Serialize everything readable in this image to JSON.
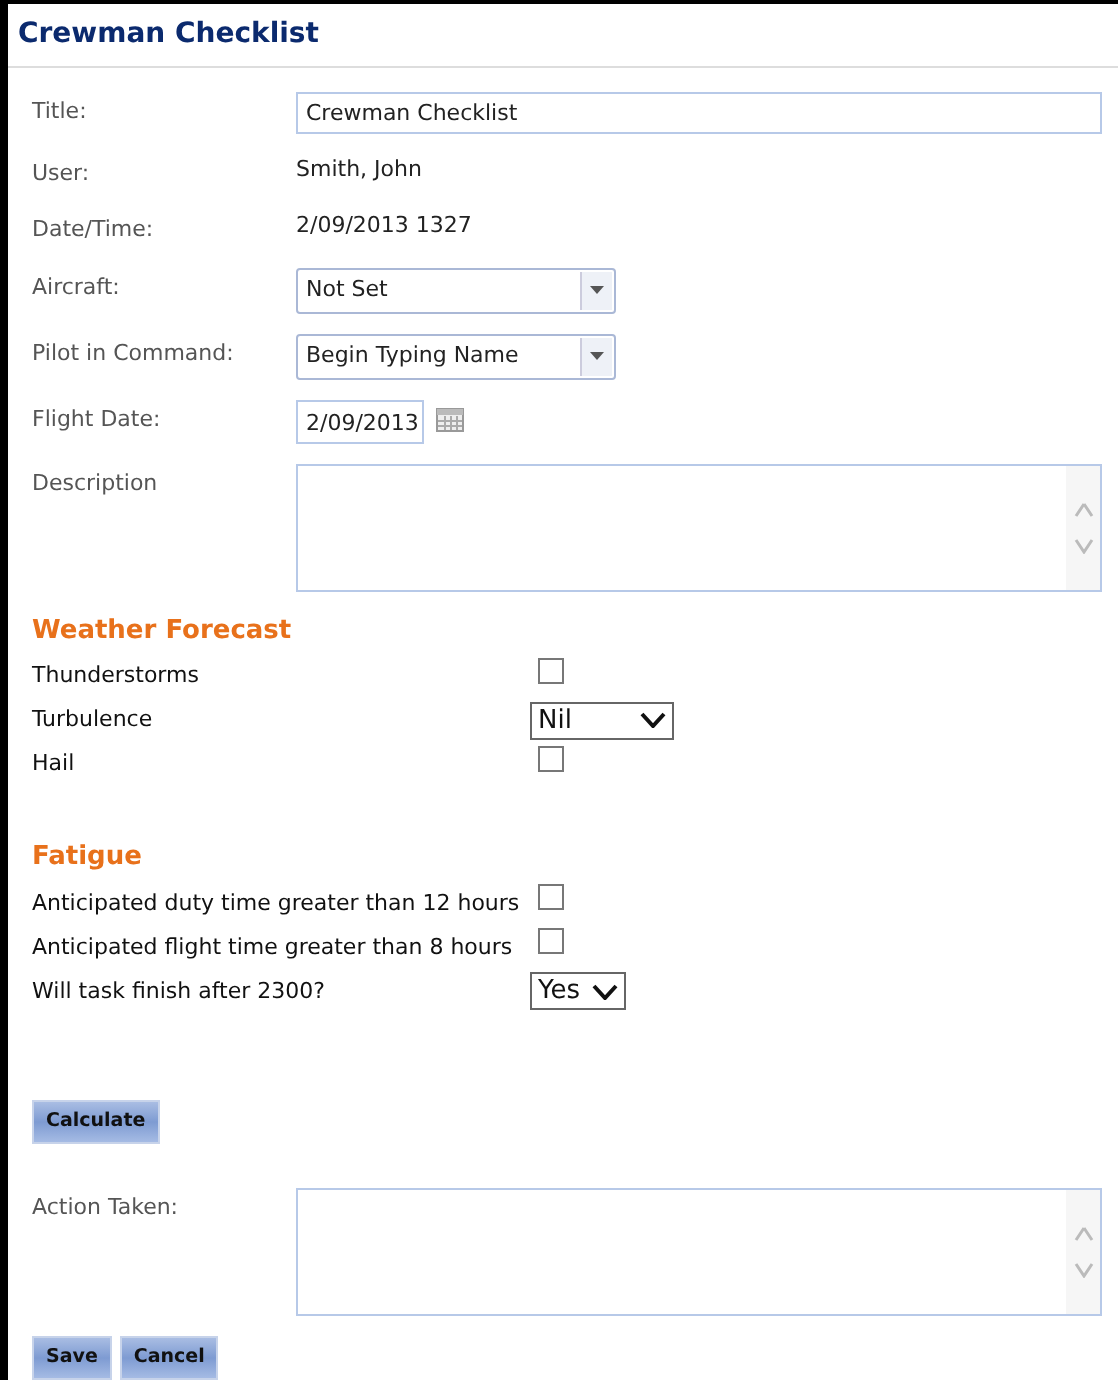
{
  "window": {
    "title": "Crewman Checklist"
  },
  "fields": [
    {
      "kind": "text",
      "label": "Title:",
      "value": "Crewman Checklist"
    },
    {
      "kind": "static",
      "label": "User:",
      "value": "Smith, John"
    },
    {
      "kind": "static",
      "label": "Date/Time:",
      "value": "2/09/2013 1327"
    },
    {
      "kind": "combo",
      "label": "Aircraft:",
      "value": "Not Set"
    },
    {
      "kind": "combo",
      "label": "Pilot in Command:",
      "value": "Begin Typing Name"
    },
    {
      "kind": "date",
      "label": "Flight Date:",
      "value": "2/09/2013"
    },
    {
      "kind": "textarea",
      "label": "Description"
    }
  ],
  "sections": [
    {
      "heading": "Weather Forecast",
      "items": [
        {
          "kind": "checkbox",
          "label": "Thunderstorms",
          "checked": false
        },
        {
          "kind": "select",
          "label": "Turbulence",
          "value": "Nil"
        },
        {
          "kind": "checkbox",
          "label": "Hail",
          "checked": false
        }
      ]
    },
    {
      "heading": "Fatigue",
      "items": [
        {
          "kind": "checkbox",
          "label": "Anticipated duty time greater than 12 hours",
          "checked": false
        },
        {
          "kind": "checkbox",
          "label": "Anticipated flight time greater than 8 hours",
          "checked": false
        },
        {
          "kind": "select",
          "label": "Will task finish after 2300?",
          "value": "Yes"
        }
      ]
    }
  ],
  "calculate_button": "Calculate",
  "action": {
    "label": "Action Taken:"
  },
  "buttons": [
    "Save",
    "Cancel"
  ]
}
